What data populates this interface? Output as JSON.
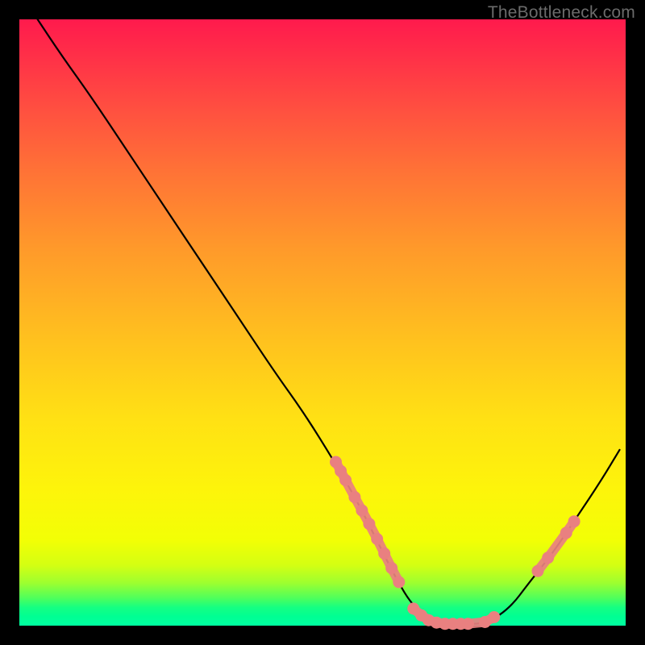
{
  "watermark": "TheBottleneck.com",
  "chart_data": {
    "type": "line",
    "title": "",
    "xlabel": "",
    "ylabel": "",
    "xlim": [
      0,
      100
    ],
    "ylim": [
      0,
      100
    ],
    "curve": {
      "name": "bottleneck-curve",
      "x": [
        3,
        7,
        12,
        18,
        24,
        30,
        36,
        42,
        47,
        52,
        56,
        59,
        62,
        65,
        69,
        73,
        77,
        81,
        84,
        88,
        92,
        96,
        99
      ],
      "y": [
        100,
        94,
        87,
        78,
        69,
        60,
        51,
        42,
        35,
        27,
        20,
        14,
        8,
        3,
        0.3,
        0.3,
        0.3,
        3,
        7,
        12,
        18,
        24,
        29
      ]
    },
    "marker_clusters": [
      {
        "name": "left-descent-pink",
        "color": "#e98080",
        "points": [
          {
            "x": 52.2,
            "y": 27
          },
          {
            "x": 53.0,
            "y": 25.5
          },
          {
            "x": 53.8,
            "y": 24
          },
          {
            "x": 55.3,
            "y": 21.2
          },
          {
            "x": 56.5,
            "y": 19
          },
          {
            "x": 57.7,
            "y": 16.8
          },
          {
            "x": 59.0,
            "y": 14.3
          },
          {
            "x": 60.2,
            "y": 11.9
          },
          {
            "x": 61.4,
            "y": 9.5
          },
          {
            "x": 62.6,
            "y": 7.2
          }
        ]
      },
      {
        "name": "valley-pink",
        "color": "#e98080",
        "points": [
          {
            "x": 65.0,
            "y": 2.8
          },
          {
            "x": 66.3,
            "y": 1.7
          },
          {
            "x": 67.5,
            "y": 0.9
          },
          {
            "x": 68.8,
            "y": 0.5
          },
          {
            "x": 70.2,
            "y": 0.3
          },
          {
            "x": 71.5,
            "y": 0.3
          },
          {
            "x": 72.8,
            "y": 0.3
          },
          {
            "x": 74.0,
            "y": 0.3
          },
          {
            "x": 76.8,
            "y": 0.6
          },
          {
            "x": 78.3,
            "y": 1.4
          }
        ]
      },
      {
        "name": "right-ascent-pink",
        "color": "#e98080",
        "points": [
          {
            "x": 85.5,
            "y": 9.0
          },
          {
            "x": 87.2,
            "y": 11.2
          },
          {
            "x": 90.2,
            "y": 15.3
          },
          {
            "x": 91.5,
            "y": 17.2
          }
        ]
      }
    ]
  }
}
